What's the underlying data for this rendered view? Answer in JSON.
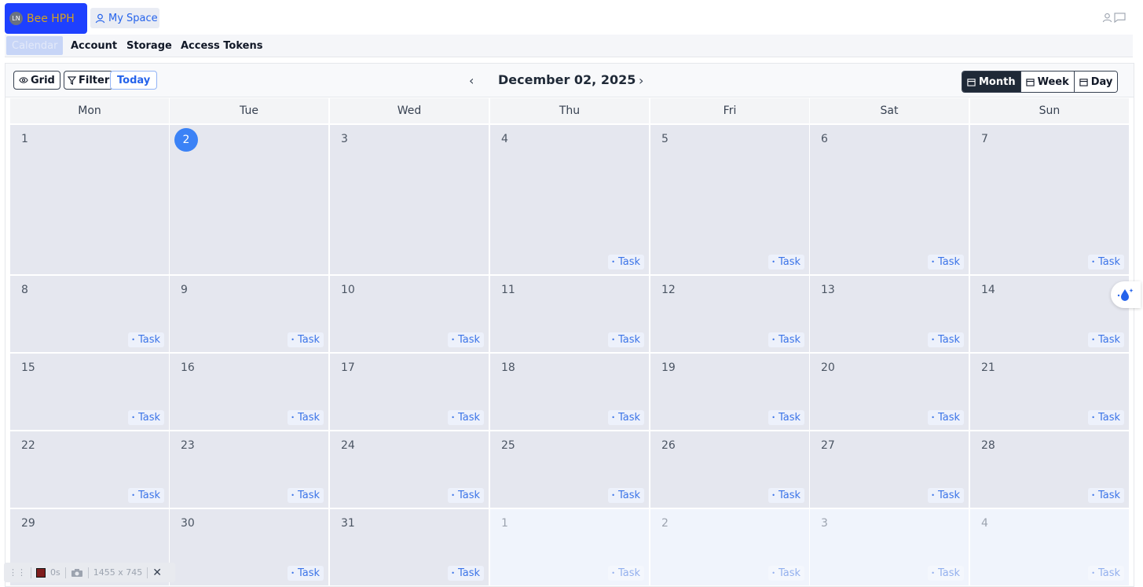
{
  "header": {
    "brand_initials": "LN",
    "brand_name": "Bee HPH",
    "my_space_label": "My Space"
  },
  "nav": {
    "tabs": [
      {
        "label": "Calendar",
        "active": true
      },
      {
        "label": "Account",
        "active": false
      },
      {
        "label": "Storage",
        "active": false
      },
      {
        "label": "Access Tokens",
        "active": false
      }
    ]
  },
  "toolbar": {
    "grid_label": "Grid",
    "filter_label": "Filter",
    "today_label": "Today",
    "prev_symbol": "‹",
    "next_symbol": "›",
    "current_date": "December 02, 2025",
    "views": [
      {
        "label": "Month",
        "active": true
      },
      {
        "label": "Week",
        "active": false
      },
      {
        "label": "Day",
        "active": false
      }
    ]
  },
  "calendar": {
    "weekdays": [
      "Mon",
      "Tue",
      "Wed",
      "Thu",
      "Fri",
      "Sat",
      "Sun"
    ],
    "task_label": "Task",
    "weeks": [
      [
        {
          "d": "1",
          "task": false
        },
        {
          "d": "2",
          "task": false,
          "today": true
        },
        {
          "d": "3",
          "task": false
        },
        {
          "d": "4",
          "task": true
        },
        {
          "d": "5",
          "task": true
        },
        {
          "d": "6",
          "task": true
        },
        {
          "d": "7",
          "task": true
        }
      ],
      [
        {
          "d": "8",
          "task": true
        },
        {
          "d": "9",
          "task": true
        },
        {
          "d": "10",
          "task": true
        },
        {
          "d": "11",
          "task": true
        },
        {
          "d": "12",
          "task": true
        },
        {
          "d": "13",
          "task": true
        },
        {
          "d": "14",
          "task": true
        }
      ],
      [
        {
          "d": "15",
          "task": true
        },
        {
          "d": "16",
          "task": true
        },
        {
          "d": "17",
          "task": true
        },
        {
          "d": "18",
          "task": true
        },
        {
          "d": "19",
          "task": true
        },
        {
          "d": "20",
          "task": true
        },
        {
          "d": "21",
          "task": true
        }
      ],
      [
        {
          "d": "22",
          "task": true
        },
        {
          "d": "23",
          "task": true
        },
        {
          "d": "24",
          "task": true
        },
        {
          "d": "25",
          "task": true
        },
        {
          "d": "26",
          "task": true
        },
        {
          "d": "27",
          "task": true
        },
        {
          "d": "28",
          "task": true
        }
      ],
      [
        {
          "d": "29",
          "task": false
        },
        {
          "d": "30",
          "task": true
        },
        {
          "d": "31",
          "task": true
        },
        {
          "d": "1",
          "task": true,
          "other": true
        },
        {
          "d": "2",
          "task": true,
          "other": true
        },
        {
          "d": "3",
          "task": true,
          "other": true
        },
        {
          "d": "4",
          "task": true,
          "other": true
        }
      ]
    ]
  },
  "recorder": {
    "time": "0s",
    "size": "1455 x 745"
  },
  "colors": {
    "brand_bg": "#1e40ff",
    "brand_text": "#d6a11e",
    "accent": "#3b82f6",
    "cell_bg": "#e5e7ef",
    "other_month_bg": "#f0f4fc"
  }
}
